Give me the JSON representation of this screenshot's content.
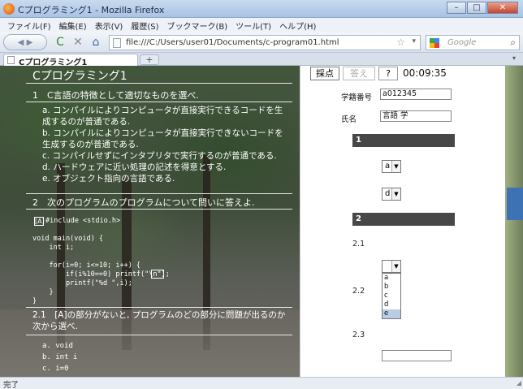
{
  "window": {
    "title": "Cプログラミング1 - Mozilla Firefox",
    "controls": {
      "minimize": "–",
      "maximize": "□",
      "close": "✕"
    }
  },
  "menubar": [
    "ファイル(F)",
    "編集(E)",
    "表示(V)",
    "履歴(S)",
    "ブックマーク(B)",
    "ツール(T)",
    "ヘルプ(H)"
  ],
  "navbar": {
    "url": "file:///C:/Users/user01/Documents/c-program01.html",
    "search_placeholder": "Google",
    "back_label": "◀ ▶",
    "reload": "C",
    "stop": "✕",
    "home": "⌂",
    "star": "☆",
    "dropdown": "▾",
    "search_icon": "⌕"
  },
  "tab": {
    "title": "Cプログラミング1",
    "new_tab": "+",
    "list": "▾"
  },
  "left": {
    "title": "Cプログラミング1",
    "q1": {
      "heading": "1　C言語の特徴として適切なものを選べ.",
      "options": [
        "a. コンパイルによりコンピュータが直接実行できるコードを生成するのが普通である.",
        "b. コンパイルによりコンピュータが直接実行できないコードを生成するのが普通である.",
        "c. コンパイルせずにインタプリタで実行するのが普通である.",
        "d. ハードウェアに近い処理の記述を得意とする.",
        "e. オブジェクト指向の言語である."
      ]
    },
    "q2": {
      "heading": "2　次のプログラムのプログラムについて問いに答えよ.",
      "code_marker": "[A]",
      "code": [
        "#include <stdio.h>",
        "",
        "void main(void) {",
        "    int i;",
        "",
        "    for(i=0; i<=10; i++) {",
        "        if(i%10==0) printf(\"\\n\");",
        "        printf(\"%d \",i);",
        "    }",
        "}"
      ],
      "sub_heading": "2.1　[A]の部分がないと, プログラムのどの部分に問題が出るのか次から選べ.",
      "sub_options": [
        "a. void",
        "b. int i",
        "c. i=0"
      ]
    }
  },
  "right": {
    "buttons": {
      "score": "採点",
      "answer": "答え",
      "help": "?"
    },
    "timer": "00:09:35",
    "student_id_label": "学籍番号",
    "student_id_value": "a012345",
    "name_label": "氏名",
    "name_value": "言語 学",
    "section1": "1",
    "section1_selects": [
      "a",
      "d"
    ],
    "section2": "2",
    "q21": "2.1",
    "q22": "2.2",
    "q23": "2.3",
    "select_arrow": "▼",
    "dropdown_options": [
      "a",
      "b",
      "c",
      "d",
      "e"
    ],
    "dropdown_highlighted": "e"
  },
  "status": "完了"
}
